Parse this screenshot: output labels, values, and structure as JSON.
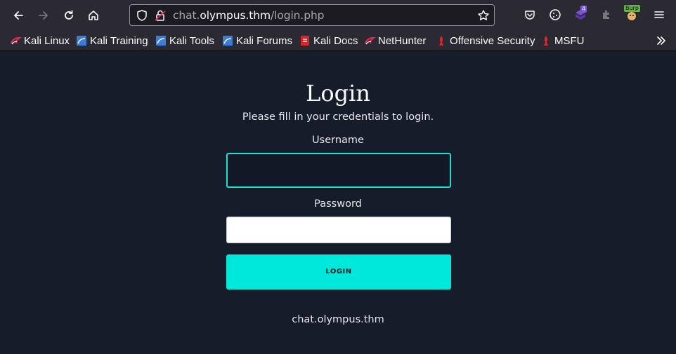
{
  "browser": {
    "url_host": "chat.",
    "url_domain": "olympus.thm",
    "url_path": "/login.php",
    "ext_badge_count": "4",
    "burp_label": "Burp"
  },
  "bookmarks": [
    {
      "label": "Kali Linux",
      "icon": "kali-dragon-icon"
    },
    {
      "label": "Kali Training",
      "icon": "kali-training-icon"
    },
    {
      "label": "Kali Tools",
      "icon": "kali-tools-icon"
    },
    {
      "label": "Kali Forums",
      "icon": "kali-forums-icon"
    },
    {
      "label": "Kali Docs",
      "icon": "kali-docs-icon"
    },
    {
      "label": "NetHunter",
      "icon": "nethunter-icon"
    },
    {
      "label": "Offensive Security",
      "icon": "offsec-icon"
    },
    {
      "label": "MSFU",
      "icon": "msfu-icon"
    }
  ],
  "login": {
    "title": "Login",
    "subtitle": "Please fill in your credentials to login.",
    "username_label": "Username",
    "username_value": "",
    "password_label": "Password",
    "password_value": "",
    "button_label": "LOGIN",
    "footer_host": "chat.olympus.thm"
  },
  "colors": {
    "page_bg": "#151c2a",
    "accent": "#00e8dc",
    "toolbar_bg": "#2b2a33"
  }
}
